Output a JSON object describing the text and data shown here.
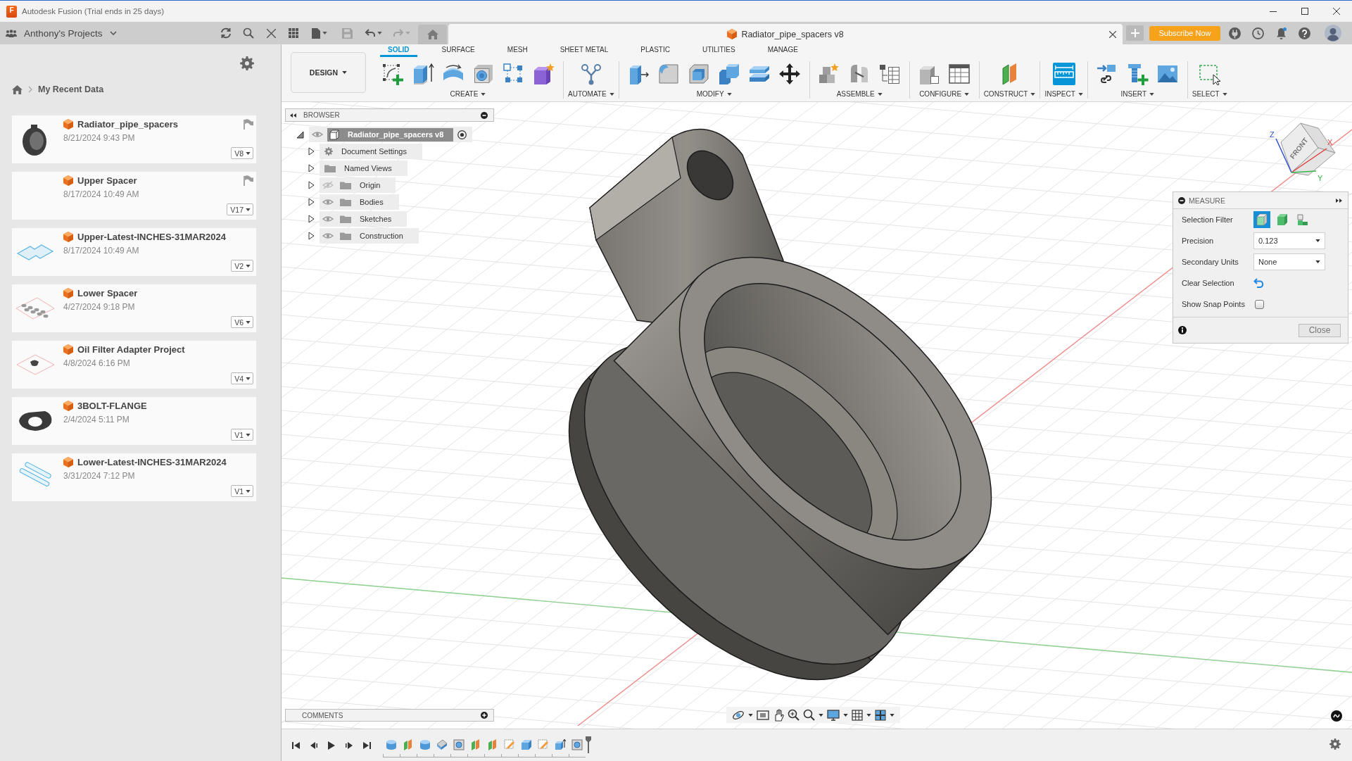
{
  "window": {
    "logo": "F",
    "title": "Autodesk Fusion (Trial ends in 25 days)"
  },
  "app_bar": {
    "project": "Anthony's Projects",
    "save": {
      "disabled": true
    },
    "undo": {
      "disabled": false
    },
    "redo": {
      "disabled": true
    },
    "document_tab": {
      "title": "Radiator_pipe_spacers v8"
    },
    "subscribe_button": "Subscribe Now"
  },
  "data_panel": {
    "breadcrumb": "My Recent Data",
    "files": [
      {
        "name": "Radiator_pipe_spacers",
        "date": "8/21/2024 9:43 PM",
        "version": "V8",
        "flagged": true,
        "thumbnail": {
          "kind": "ring"
        }
      },
      {
        "name": "Upper Spacer",
        "date": "8/17/2024 10:49 AM",
        "version": "V17",
        "flagged": true
      },
      {
        "name": "Upper-Latest-INCHES-31MAR2024",
        "date": "8/17/2024 10:49 AM",
        "version": "V2",
        "flagged": false,
        "thumbnail": {
          "kind": "plate"
        }
      },
      {
        "name": "Lower Spacer",
        "date": "4/27/2024 9:18 PM",
        "version": "V6",
        "flagged": false,
        "thumbnail": {
          "kind": "holes"
        }
      },
      {
        "name": "Oil Filter Adapter Project",
        "date": "4/8/2024 6:16 PM",
        "version": "V4",
        "flagged": false,
        "thumbnail": {
          "kind": "part"
        }
      },
      {
        "name": "3BOLT-FLANGE",
        "date": "2/4/2024 5:11 PM",
        "version": "V1",
        "flagged": false,
        "thumbnail": {
          "kind": "flange"
        }
      },
      {
        "name": "Lower-Latest-INCHES-31MAR2024",
        "date": "3/31/2024 7:12 PM",
        "version": "V1",
        "flagged": false,
        "thumbnail": {
          "kind": "strips"
        }
      }
    ]
  },
  "toolbar": {
    "workspace": "DESIGN",
    "tabs": [
      {
        "label": "SOLID",
        "selected": true
      },
      {
        "label": "SURFACE",
        "selected": false
      },
      {
        "label": "MESH",
        "selected": false
      },
      {
        "label": "SHEET METAL",
        "selected": false
      },
      {
        "label": "PLASTIC",
        "selected": false
      },
      {
        "label": "UTILITIES",
        "selected": false
      },
      {
        "label": "MANAGE",
        "selected": false
      }
    ],
    "groups": [
      {
        "label": "CREATE",
        "tools": [
          {
            "active": false
          },
          {
            "active": false
          },
          {
            "active": false
          },
          {
            "active": false
          },
          {
            "active": false
          },
          {
            "active": false
          }
        ]
      },
      {
        "label": "AUTOMATE",
        "tools": [
          {
            "active": false
          }
        ]
      },
      {
        "label": "MODIFY",
        "tools": [
          {
            "active": false
          },
          {
            "active": false
          },
          {
            "active": false
          },
          {
            "active": false
          },
          {
            "active": false
          },
          {
            "active": false
          }
        ]
      },
      {
        "label": "ASSEMBLE",
        "tools": [
          {
            "active": false
          },
          {
            "active": false
          },
          {
            "active": false
          }
        ]
      },
      {
        "label": "CONFIGURE",
        "tools": [
          {
            "active": false
          },
          {
            "active": false
          }
        ]
      },
      {
        "label": "CONSTRUCT",
        "tools": [
          {
            "active": false
          }
        ]
      },
      {
        "label": "INSPECT",
        "tools": [
          {
            "active": true
          }
        ]
      },
      {
        "label": "INSERT",
        "tools": [
          {
            "active": false
          },
          {
            "active": false
          },
          {
            "active": false
          }
        ]
      },
      {
        "label": "SELECT",
        "tools": [
          {
            "active": false
          }
        ]
      }
    ]
  },
  "browser": {
    "title": "BROWSER",
    "items": [
      {
        "label": "Radiator_pipe_spacers v8",
        "kind": "component",
        "expanded": true,
        "selected": true,
        "visible": true,
        "children": [
          {
            "label": "Document Settings",
            "kind": "settings",
            "expanded": false,
            "selected": false
          },
          {
            "label": "Named Views",
            "kind": "folder",
            "expanded": false,
            "selected": false
          },
          {
            "label": "Origin",
            "kind": "folder",
            "expanded": false,
            "selected": false,
            "visible": false
          },
          {
            "label": "Bodies",
            "kind": "folder",
            "expanded": false,
            "selected": false,
            "visible": true
          },
          {
            "label": "Sketches",
            "kind": "folder",
            "expanded": false,
            "selected": false,
            "visible": true
          },
          {
            "label": "Construction",
            "kind": "folder",
            "expanded": false,
            "selected": false,
            "visible": true
          }
        ]
      }
    ]
  },
  "measure": {
    "title": "MEASURE",
    "rows": [
      {
        "kind": "filter",
        "label": "Selection Filter",
        "options": [
          {
            "selected": true
          },
          {
            "selected": false
          },
          {
            "selected": false
          }
        ]
      },
      {
        "kind": "dropdown",
        "label": "Precision",
        "value": "0.123"
      },
      {
        "kind": "dropdown",
        "label": "Secondary Units",
        "value": "None"
      },
      {
        "kind": "action",
        "label": "Clear Selection"
      },
      {
        "kind": "checkbox",
        "label": "Show Snap Points",
        "checked": false
      }
    ],
    "close_button": "Close"
  },
  "view_cube": {
    "face": "FRONT",
    "axes": [
      "Z",
      "X",
      "Y"
    ]
  },
  "comments": {
    "title": "COMMENTS"
  }
}
